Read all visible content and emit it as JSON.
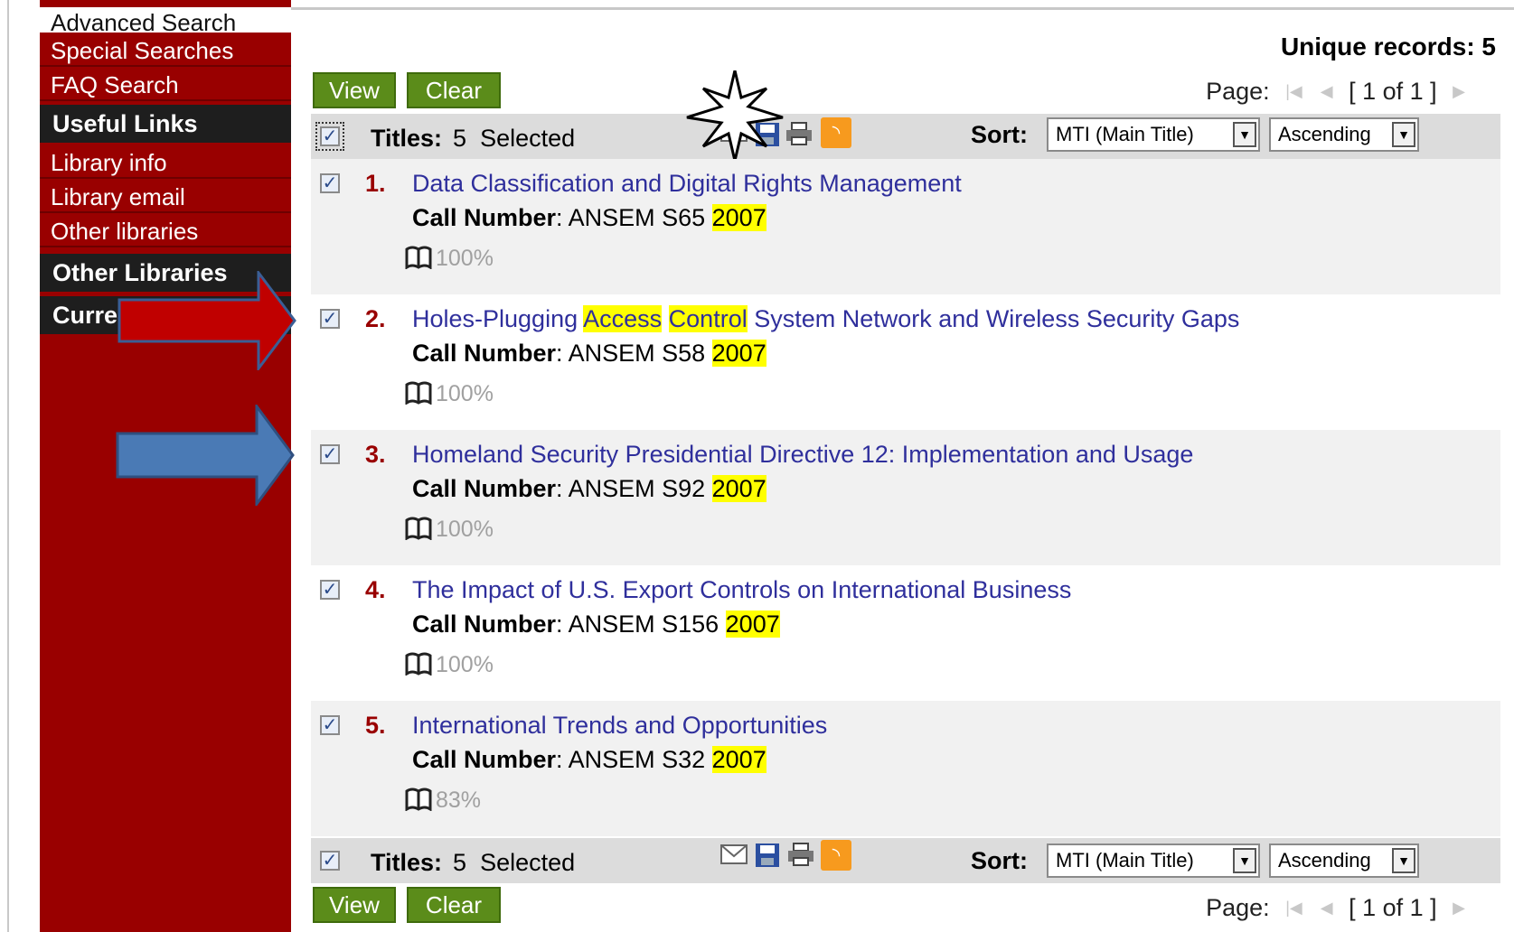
{
  "sidebar": {
    "items": [
      {
        "label": "Advanced Search"
      },
      {
        "label": "Special Searches"
      },
      {
        "label": "FAQ Search"
      }
    ],
    "useful_links_heading": "Useful Links",
    "useful_links": [
      {
        "label": "Library info"
      },
      {
        "label": "Library email"
      },
      {
        "label": "Other libraries"
      }
    ],
    "other_libraries_heading": "Other Libraries",
    "current_heading": "Curre"
  },
  "results": {
    "unique_records": "Unique records: 5",
    "view_label": "View",
    "clear_label": "Clear",
    "page_label": "Page:",
    "page_value": "[ 1 of 1 ]",
    "titles_label": "Titles:",
    "titles_count": "5",
    "selected_label": "Selected",
    "sort_label": "Sort:",
    "sort_field": "MTI (Main Title)",
    "sort_order": "Ascending",
    "icons": [
      "email-icon",
      "save-icon",
      "print-icon",
      "rss-icon"
    ],
    "call_number_label": "Call Number",
    "records": [
      {
        "num": "1.",
        "title_parts": [
          "Data Classification and Digital Rights Management"
        ],
        "call": "ANSEM S65",
        "year": "2007",
        "avail": "100%"
      },
      {
        "num": "2.",
        "title_pre": "Holes-Plugging ",
        "hl1": "Access",
        "mid": " ",
        "hl2": "Control",
        "title_post": " System Network and Wireless Security Gaps",
        "call": "ANSEM S58",
        "year": "2007",
        "avail": "100%"
      },
      {
        "num": "3.",
        "title_parts": [
          "Homeland Security Presidential Directive 12: Implementation and Usage"
        ],
        "call": "ANSEM S92",
        "year": "2007",
        "avail": "100%"
      },
      {
        "num": "4.",
        "title_parts": [
          "The Impact of U.S. Export Controls on International Business"
        ],
        "call": "ANSEM S156",
        "year": "2007",
        "avail": "100%"
      },
      {
        "num": "5.",
        "title_parts": [
          "International Trends and Opportunities"
        ],
        "call": "ANSEM S32",
        "year": "2007",
        "avail": "83%"
      }
    ]
  },
  "colors": {
    "sidebar": "#990000",
    "button": "#5b8c1a",
    "highlight": "#ffff00",
    "link": "#2f2f9c",
    "red_arrow": "#c00000",
    "blue_arrow": "#4a7ab5"
  }
}
